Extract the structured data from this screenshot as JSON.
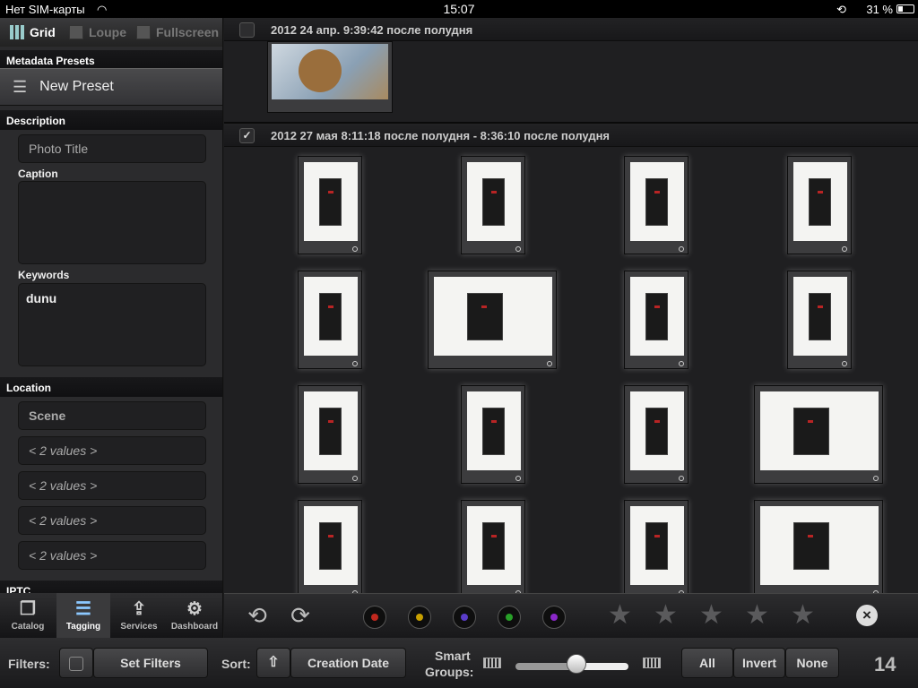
{
  "status": {
    "carrier": "Нет SIM-карты",
    "time": "15:07",
    "battery": "31 %"
  },
  "modes": {
    "grid": "Grid",
    "loupe": "Loupe",
    "fullscreen": "Fullscreen"
  },
  "sections": {
    "metadata_presets": "Metadata Presets",
    "description": "Description",
    "location": "Location",
    "iptc": "IPTC"
  },
  "preset": {
    "label": "New Preset"
  },
  "description": {
    "photo_title_placeholder": "Photo Title",
    "caption_label": "Caption",
    "caption_value": "",
    "keywords_label": "Keywords",
    "keywords_value": "dunu"
  },
  "location": {
    "scene_placeholder": "Scene",
    "values": [
      "< 2 values >",
      "< 2 values >",
      "< 2 values >",
      "< 2 values >"
    ]
  },
  "tabs": [
    {
      "label": "Catalog",
      "icon": "catalog-icon"
    },
    {
      "label": "Tagging",
      "icon": "tagging-icon",
      "active": true
    },
    {
      "label": "Services",
      "icon": "share-icon"
    },
    {
      "label": "Dashboard",
      "icon": "gear-icon"
    }
  ],
  "groups": [
    {
      "title": "2012 24 апр. 9:39:42 после полудня",
      "checked": false
    },
    {
      "title": "2012 27 мая 8:11:18 после полудня - 8:36:10 после полудня",
      "checked": true
    }
  ],
  "color_labels": [
    "#c0281e",
    "#c8a000",
    "#5a3cc8",
    "#28a028",
    "#8a28c8"
  ],
  "star_rating": {
    "max": 5,
    "value": 0
  },
  "bottom": {
    "filters_label": "Filters:",
    "set_filters": "Set Filters",
    "sort_label": "Sort:",
    "sort_value": "Creation Date",
    "smart_groups_label_1": "Smart",
    "smart_groups_label_2": "Groups:",
    "smart_groups_level": 0.54,
    "select_all": "All",
    "invert": "Invert",
    "none": "None",
    "count": "14"
  }
}
